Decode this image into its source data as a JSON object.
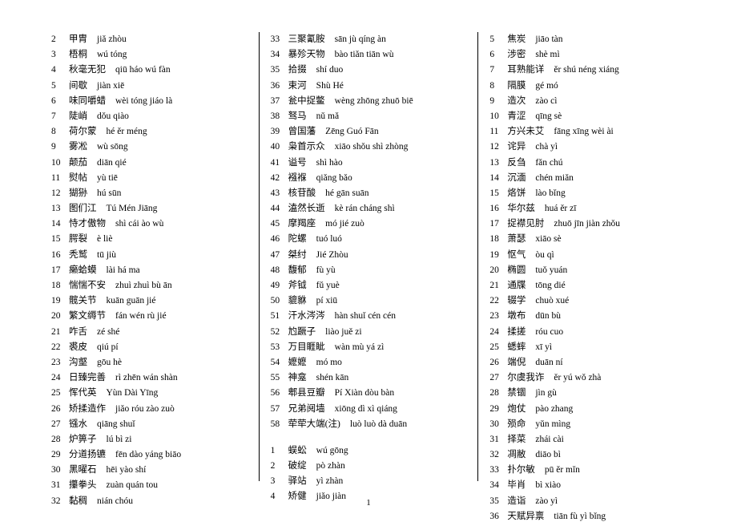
{
  "page_number": "1",
  "columns": [
    {
      "entries": [
        {
          "n": "2",
          "h": "甲胄",
          "p": "jiǎ zhòu"
        },
        {
          "n": "3",
          "h": "梧桐",
          "p": "wú tóng"
        },
        {
          "n": "4",
          "h": "秋毫无犯",
          "p": "qiū háo wú fàn"
        },
        {
          "n": "5",
          "h": "间歇",
          "p": "jiàn xiē"
        },
        {
          "n": "6",
          "h": "味同嚼蜡",
          "p": "wèi tóng jiáo là"
        },
        {
          "n": "7",
          "h": "陡峭",
          "p": "dǒu qiào"
        },
        {
          "n": "8",
          "h": "荷尔蒙",
          "p": "hé ěr méng"
        },
        {
          "n": "9",
          "h": "雾凇",
          "p": "wù sōng"
        },
        {
          "n": "10",
          "h": "颠茄",
          "p": "diān qié"
        },
        {
          "n": "11",
          "h": "熨帖",
          "p": "yù tiē"
        },
        {
          "n": "12",
          "h": "猢狲",
          "p": "hú sūn"
        },
        {
          "n": "13",
          "h": "图们江",
          "p": "Tú Mén Jiāng"
        },
        {
          "n": "14",
          "h": "恃才傲物",
          "p": "shì cái ào wù"
        },
        {
          "n": "15",
          "h": "腭裂",
          "p": "è liè"
        },
        {
          "n": "16",
          "h": "秃鹫",
          "p": "tū jiù"
        },
        {
          "n": "17",
          "h": "癞蛤蟆",
          "p": "lài há ma"
        },
        {
          "n": "18",
          "h": "惴惴不安",
          "p": "zhuì zhuì bù ān"
        },
        {
          "n": "19",
          "h": "髋关节",
          "p": "kuān guān jié"
        },
        {
          "n": "20",
          "h": "繁文缛节",
          "p": "fán wén rù jié"
        },
        {
          "n": "21",
          "h": "咋舌",
          "p": "zé shé"
        },
        {
          "n": "22",
          "h": "裘皮",
          "p": "qiú pí"
        },
        {
          "n": "23",
          "h": "沟壑",
          "p": "gōu hè"
        },
        {
          "n": "24",
          "h": "日臻完善",
          "p": "rì zhēn wán shàn"
        },
        {
          "n": "25",
          "h": "恽代英",
          "p": "Yùn Dài Yīng"
        },
        {
          "n": "26",
          "h": "矫揉造作",
          "p": "jiǎo róu zào zuò"
        },
        {
          "n": "27",
          "h": "镪水",
          "p": "qiāng shuǐ"
        },
        {
          "n": "28",
          "h": "炉箅子",
          "p": "lú bì zi"
        },
        {
          "n": "29",
          "h": "分道扬镳",
          "p": "fēn dào yáng biāo"
        },
        {
          "n": "30",
          "h": "黑曜石",
          "p": "hēi yào shí"
        },
        {
          "n": "31",
          "h": "攥拳头",
          "p": "zuàn quán tou"
        },
        {
          "n": "32",
          "h": "黏稠",
          "p": "nián chóu"
        }
      ]
    },
    {
      "entries": [
        {
          "n": "33",
          "h": "三聚氰胺",
          "p": "sān jù qíng àn"
        },
        {
          "n": "34",
          "h": "暴殄天物",
          "p": "bào tiǎn tiān wù"
        },
        {
          "n": "35",
          "h": "拾掇",
          "p": "shí duo"
        },
        {
          "n": "36",
          "h": "束河",
          "p": "Shù Hé"
        },
        {
          "n": "37",
          "h": "瓮中捉鳖",
          "p": "wèng zhōng zhuō biē"
        },
        {
          "n": "38",
          "h": "驽马",
          "p": "nǔ mǎ"
        },
        {
          "n": "39",
          "h": "曾国藩",
          "p": "Zēng Guó Fān"
        },
        {
          "n": "40",
          "h": "枭首示众",
          "p": "xiāo shǒu shì zhòng"
        },
        {
          "n": "41",
          "h": "谥号",
          "p": "shì hào"
        },
        {
          "n": "42",
          "h": "襁褓",
          "p": "qiǎng bǎo"
        },
        {
          "n": "43",
          "h": "核苷酸",
          "p": "hé gān suān"
        },
        {
          "n": "44",
          "h": "溘然长逝",
          "p": "kè rán cháng shì"
        },
        {
          "n": "45",
          "h": "摩羯座",
          "p": "mó jié zuò"
        },
        {
          "n": "46",
          "h": "陀螺",
          "p": "tuó luó"
        },
        {
          "n": "47",
          "h": "桀纣",
          "p": "Jié Zhòu"
        },
        {
          "n": "48",
          "h": "馥郁",
          "p": "fù yù"
        },
        {
          "n": "49",
          "h": "斧钺",
          "p": "fǔ yuè"
        },
        {
          "n": "50",
          "h": "貔貅",
          "p": "pí xiū"
        },
        {
          "n": "51",
          "h": "汗水涔涔",
          "p": "hàn shuǐ cén cén"
        },
        {
          "n": "52",
          "h": "尥蹶子",
          "p": "liào juě zi"
        },
        {
          "n": "53",
          "h": "万目睚眦",
          "p": "wàn mù yá zì"
        },
        {
          "n": "54",
          "h": "嬷嬷",
          "p": "mó mo"
        },
        {
          "n": "55",
          "h": "神龛",
          "p": "shén kān"
        },
        {
          "n": "56",
          "h": "郫县豆瓣",
          "p": "Pí Xiàn dòu bàn"
        },
        {
          "n": "57",
          "h": "兄弟阋墙",
          "p": "xiōng dì xì qiáng"
        },
        {
          "n": "58",
          "h": "荦荦大端(注)",
          "p": "luò luò dà duān"
        },
        {
          "spacer": true
        },
        {
          "n": "1",
          "h": "蜈蚣",
          "p": "wú gōng"
        },
        {
          "n": "2",
          "h": "破绽",
          "p": "pò zhàn"
        },
        {
          "n": "3",
          "h": "驿站",
          "p": "yì zhàn"
        },
        {
          "n": "4",
          "h": "矫健",
          "p": "jiǎo jiàn"
        }
      ]
    },
    {
      "entries": [
        {
          "n": "5",
          "h": "焦炭",
          "p": "jiāo tàn"
        },
        {
          "n": "6",
          "h": "涉密",
          "p": "shè mì"
        },
        {
          "n": "7",
          "h": "耳熟能详",
          "p": "ěr shú néng xiáng"
        },
        {
          "n": "8",
          "h": "隔膜",
          "p": "gé mó"
        },
        {
          "n": "9",
          "h": "造次",
          "p": "zào cì"
        },
        {
          "n": "10",
          "h": "青涩",
          "p": "qīng sè"
        },
        {
          "n": "11",
          "h": "方兴未艾",
          "p": "fāng xīng wèi ài"
        },
        {
          "n": "12",
          "h": "诧异",
          "p": "chà yì"
        },
        {
          "n": "13",
          "h": "反刍",
          "p": "fǎn chú"
        },
        {
          "n": "14",
          "h": "沉湎",
          "p": "chén miǎn"
        },
        {
          "n": "15",
          "h": "烙饼",
          "p": "lào bǐng"
        },
        {
          "n": "16",
          "h": "华尔兹",
          "p": "huá ěr zī"
        },
        {
          "n": "17",
          "h": "捉襟见肘",
          "p": "zhuō jīn jiàn zhǒu"
        },
        {
          "n": "18",
          "h": "萧瑟",
          "p": "xiāo sè"
        },
        {
          "n": "19",
          "h": "怄气",
          "p": "òu qì"
        },
        {
          "n": "20",
          "h": "椭圆",
          "p": "tuǒ yuán"
        },
        {
          "n": "21",
          "h": "通牒",
          "p": "tōng dié"
        },
        {
          "n": "22",
          "h": "辍学",
          "p": "chuò xué"
        },
        {
          "n": "23",
          "h": "墩布",
          "p": "dūn bù"
        },
        {
          "n": "24",
          "h": "揉搓",
          "p": "róu cuo"
        },
        {
          "n": "25",
          "h": "蟋蟀",
          "p": "xī yì"
        },
        {
          "n": "26",
          "h": "端倪",
          "p": "duān ní"
        },
        {
          "n": "27",
          "h": "尔虞我诈",
          "p": "ěr yú wǒ zhà"
        },
        {
          "n": "28",
          "h": "禁锢",
          "p": "jìn gù"
        },
        {
          "n": "29",
          "h": "炮仗",
          "p": "pào zhang"
        },
        {
          "n": "30",
          "h": "殒命",
          "p": "yǔn mìng"
        },
        {
          "n": "31",
          "h": "择菜",
          "p": "zhái cài"
        },
        {
          "n": "32",
          "h": "凋敝",
          "p": "diāo bì"
        },
        {
          "n": "33",
          "h": "扑尔敏",
          "p": "pū ěr mǐn"
        },
        {
          "n": "34",
          "h": "毕肖",
          "p": "bì xiào"
        },
        {
          "n": "35",
          "h": "造诣",
          "p": "zào yì"
        },
        {
          "n": "36",
          "h": "天赋异禀",
          "p": "tiān fù yì bǐng"
        }
      ]
    }
  ]
}
